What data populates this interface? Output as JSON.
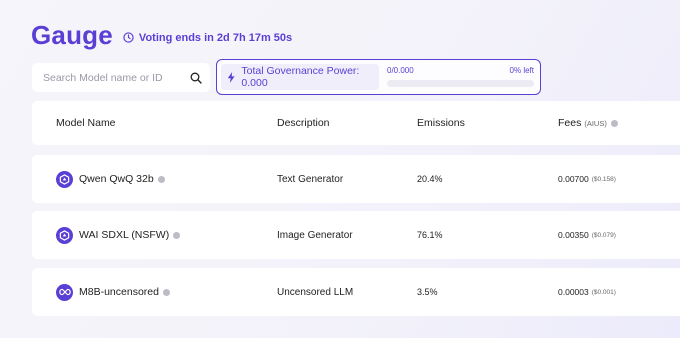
{
  "header": {
    "title": "Gauge",
    "voting_text": "Voting ends in 2d 7h 17m 50s"
  },
  "search": {
    "placeholder": "Search Model name or ID",
    "value": ""
  },
  "governance": {
    "label": "Total Governance Power: 0.000",
    "used_fraction": "0/0.000",
    "left_text": "0% left",
    "used_ratio": 0
  },
  "table": {
    "columns": {
      "name": "Model Name",
      "description": "Description",
      "emissions": "Emissions",
      "fees": "Fees",
      "fees_unit": "(AIUS)"
    },
    "rows": [
      {
        "name": "Qwen QwQ 32b",
        "description": "Text Generator",
        "emissions": "20.4%",
        "fee": "0.00700",
        "fee_usd": "($0.158)",
        "icon": "qwen-icon"
      },
      {
        "name": "WAI SDXL (NSFW)",
        "description": "Image Generator",
        "emissions": "76.1%",
        "fee": "0.00350",
        "fee_usd": "($0.079)",
        "icon": "wai-icon"
      },
      {
        "name": "M8B-uncensored",
        "description": "Uncensored LLM",
        "emissions": "3.5%",
        "fee": "0.00003",
        "fee_usd": "($0.001)",
        "icon": "meta-infinity-icon"
      }
    ]
  },
  "colors": {
    "accent": "#5b3fd4",
    "background": "#f3f2fa"
  }
}
